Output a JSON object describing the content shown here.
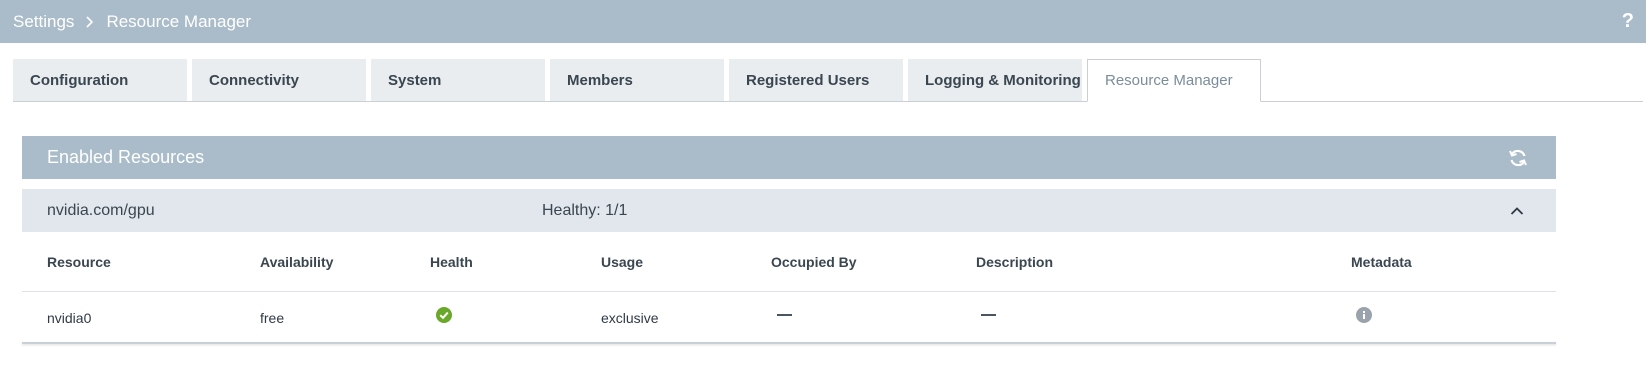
{
  "header": {
    "breadcrumb": [
      "Settings",
      "Resource Manager"
    ],
    "help_label": "?"
  },
  "tabs": [
    {
      "label": "Configuration"
    },
    {
      "label": "Connectivity"
    },
    {
      "label": "System"
    },
    {
      "label": "Members"
    },
    {
      "label": "Registered Users"
    },
    {
      "label": "Logging & Monitoring"
    },
    {
      "label": "Resource Manager",
      "active": true
    }
  ],
  "panel": {
    "title": "Enabled Resources",
    "refresh_icon": "refresh-icon"
  },
  "group": {
    "name": "nvidia.com/gpu",
    "health": "Healthy: 1/1",
    "expanded": true
  },
  "table": {
    "columns": [
      "Resource",
      "Availability",
      "Health",
      "Usage",
      "Occupied By",
      "Description",
      "Metadata"
    ],
    "rows": [
      {
        "resource": "nvidia0",
        "availability": "free",
        "health_icon": "check-circle-icon",
        "usage": "exclusive",
        "occupied_by": "—",
        "description": "—",
        "metadata_icon": "info-icon"
      }
    ]
  },
  "colors": {
    "header_bg": "#aabcc9",
    "tab_bg": "#e9edf0",
    "group_bg": "#e1e7ec",
    "healthy": "#6aa82a",
    "info_icon": "#9aa3ab"
  }
}
